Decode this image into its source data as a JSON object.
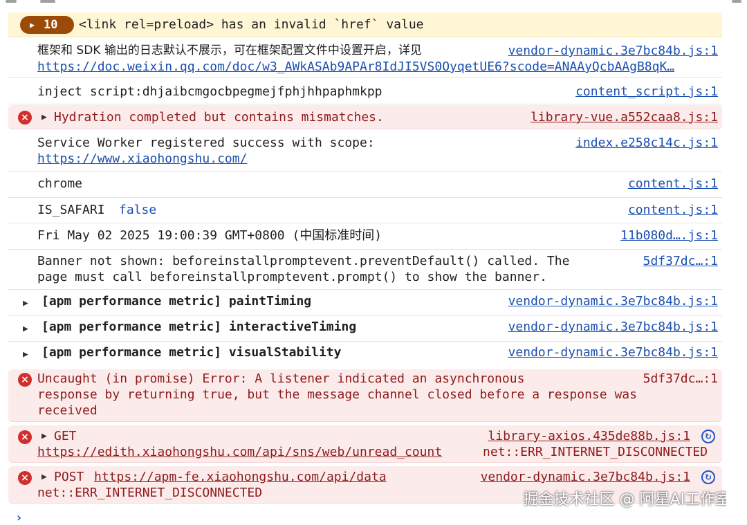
{
  "console": {
    "warning_group": {
      "count": "10",
      "message": "<link rel=preload> has an invalid `href` value"
    },
    "entries": [
      {
        "text": "框架和 SDK 输出的日志默认不展示，可在框架配置文件中设置开启，详见",
        "source": "vendor-dynamic.3e7bc84b.js:1",
        "url": "https://doc.weixin.qq.com/doc/w3_AWkASAb9APAr8IdJI5VS0OyqetUE6?scode=ANAAyQcbAAgB8qK…"
      },
      {
        "text": "inject script:dhjaibcmgocbpegmejfphjhhpaphmkpp",
        "source": "content_script.js:1"
      },
      {
        "text": "Hydration completed but contains mismatches.",
        "source": "library-vue.a552caa8.js:1",
        "level": "error"
      },
      {
        "text": "Service Worker registered success with scope:",
        "url": "https://www.xiaohongshu.com/",
        "source": "index.e258c14c.js:1"
      },
      {
        "text": "chrome",
        "source": "content.js:1"
      },
      {
        "label": "IS_SAFARI",
        "value": "false",
        "source": "content.js:1"
      },
      {
        "text": "Fri May 02 2025 19:00:39 GMT+0800 (中国标准时间)",
        "source": "11b080d….js:1"
      },
      {
        "line1": "Banner not shown: beforeinstallpromptevent.preventDefault() called. The",
        "line2": "page must call beforeinstallpromptevent.prompt() to show the banner.",
        "source": "5df37dc…:1"
      },
      {
        "text": "[apm performance metric] paintTiming",
        "source": "vendor-dynamic.3e7bc84b.js:1"
      },
      {
        "text": "[apm performance metric] interactiveTiming",
        "source": "vendor-dynamic.3e7bc84b.js:1"
      },
      {
        "text": "[apm performance metric] visualStability",
        "source": "vendor-dynamic.3e7bc84b.js:1"
      },
      {
        "line1": "Uncaught (in promise) Error: A listener indicated an asynchronous",
        "line2": "response by returning true, but the message channel closed before a response was",
        "line3": "received",
        "source": "5df37dc…:1",
        "level": "error"
      },
      {
        "method": "GET",
        "url": "https://edith.xiaohongshu.com/api/sns/web/unread_count",
        "status": "net::ERR_INTERNET_DISCONNECTED",
        "source": "library-axios.435de88b.js:1",
        "level": "error"
      },
      {
        "method": "POST",
        "url": "https://apm-fe.xiaohongshu.com/api/data",
        "status": "net::ERR_INTERNET_DISCONNECTED",
        "source": "vendor-dynamic.3e7bc84b.js:1",
        "level": "error"
      }
    ]
  },
  "watermark": "掘金技术社区 @ 阿星AI工作室",
  "prompt_symbol": "›",
  "icons": {
    "error": "×",
    "expand": "▶",
    "network": "↻"
  },
  "colors": {
    "warning_bg": "#fef6d5",
    "error_bg": "#fcebeb",
    "badge": "#9c4a08",
    "link": "#1a4fb0",
    "error_icon": "#d12e2e"
  }
}
